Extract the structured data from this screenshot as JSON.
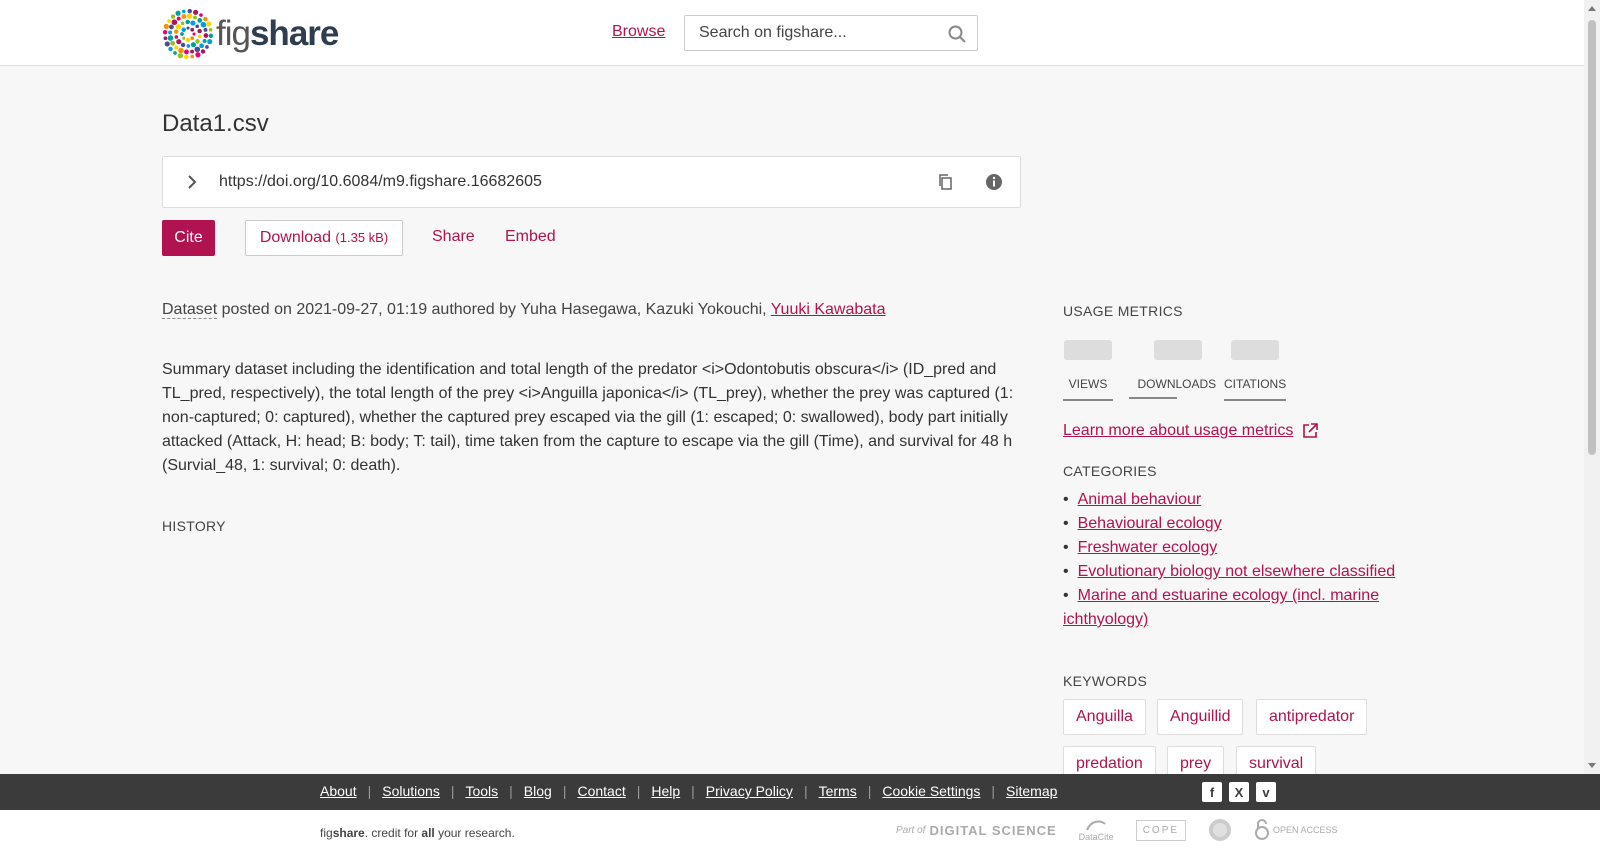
{
  "header": {
    "logo_text_light": "fig",
    "logo_text_bold": "share",
    "browse_label": "Browse",
    "search_placeholder": "Search on figshare..."
  },
  "item": {
    "title": "Data1.csv",
    "doi_url": "https://doi.org/10.6084/m9.figshare.16682605",
    "actions": {
      "cite": "Cite",
      "download": "Download",
      "download_size": "(1.35 kB)",
      "share": "Share",
      "embed": "Embed"
    },
    "posted": {
      "type": "Dataset",
      "text": " posted on 2021-09-27, 01:19 authored by Yuha Hasegawa, Kazuki Yokouchi, ",
      "linked_author": "Yuuki Kawabata"
    },
    "description": "Summary dataset including the identification and total length of the predator <i>Odontobutis obscura</i> (ID_pred and TL_pred, respectively), the total length of the prey <i>Anguilla japonica</i> (TL_prey), whether the prey was captured (1: non-captured; 0: captured), whether the captured prey escaped via the gill (1: escaped; 0: swallowed), body part initially attacked (Attack, H: head; B: body; T: tail), time taken from the capture to escape via the gill (Time), and survival for 48 h (Survial_48, 1: survival; 0: death).",
    "history_heading": "HISTORY"
  },
  "sidebar": {
    "usage_heading": "USAGE METRICS",
    "metrics": [
      {
        "label": "VIEWS"
      },
      {
        "label": "DOWNLOADS"
      },
      {
        "label": "CITATIONS"
      }
    ],
    "learn_more": "Learn more about usage metrics",
    "categories_heading": "CATEGORIES",
    "categories": [
      "Animal behaviour",
      "Behavioural ecology",
      "Freshwater ecology",
      "Evolutionary biology not elsewhere classified",
      "Marine and estuarine ecology (incl. marine ichthyology)"
    ],
    "keywords_heading": "KEYWORDS",
    "keywords": [
      "Anguilla",
      "Anguillid",
      "antipredator",
      "predation",
      "prey",
      "survival"
    ]
  },
  "footer": {
    "links": [
      "About",
      "Solutions",
      "Tools",
      "Blog",
      "Contact",
      "Help",
      "Privacy Policy",
      "Terms",
      "Cookie Settings",
      "Sitemap"
    ],
    "social_icons": [
      "facebook-icon",
      "x-icon",
      "vimeo-icon"
    ],
    "credit_a": "fig",
    "credit_b": "share",
    "credit_c": ". credit for ",
    "credit_d": "all",
    "credit_e": " your research.",
    "partners": [
      "Part of",
      "DIGITAL SCIENCE",
      "DataCite",
      "COPE",
      "",
      "OPEN ACCESS"
    ]
  },
  "colors": {
    "accent": "#b0134f",
    "footer_bg": "#3b3b3b",
    "page_bg": "#f7f7f7"
  }
}
